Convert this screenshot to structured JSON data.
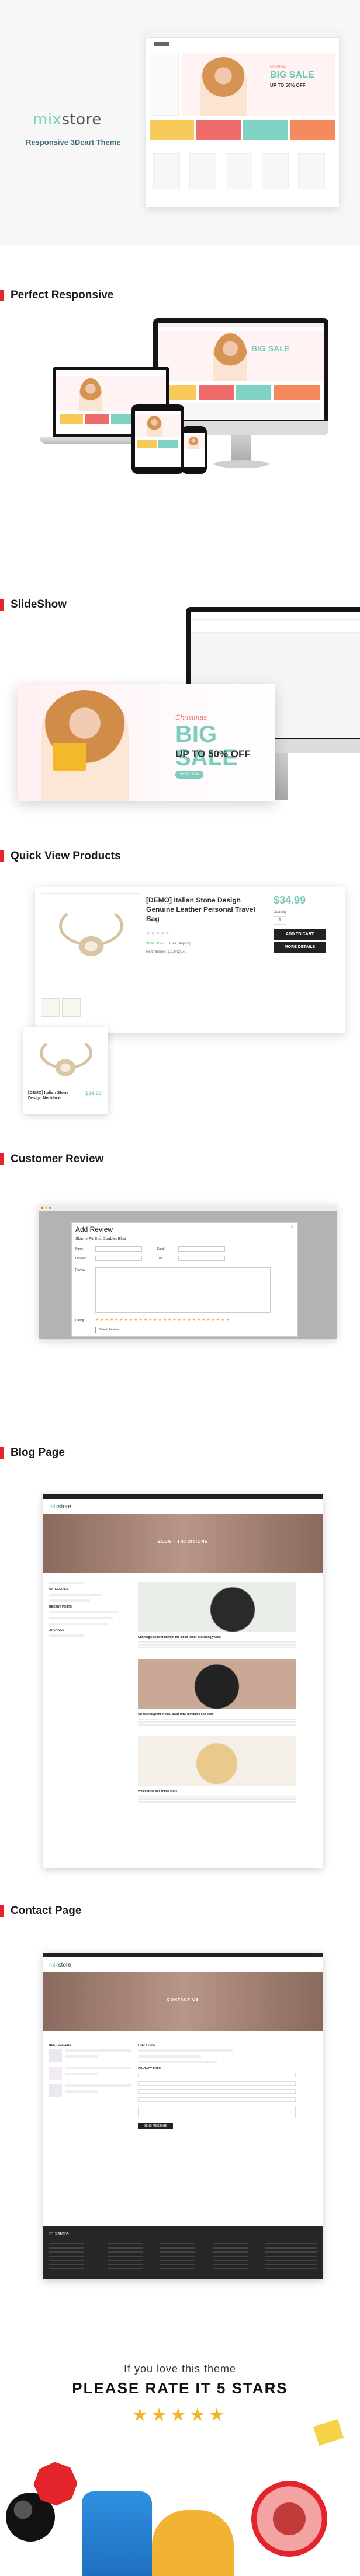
{
  "hero": {
    "logo_prefix": "mix",
    "logo_suffix": "store",
    "tagline": "Responsive 3Dcart Theme",
    "preview": {
      "sale_small": "Christmas",
      "sale_big": "BIG SALE",
      "sale_off": "UP TO 50% OFF"
    }
  },
  "sections": {
    "responsive": "Perfect Responsive",
    "slideshow": "SlideShow",
    "quickview": "Quick View Products",
    "review": "Customer Review",
    "blog": "Blog Page",
    "contact": "Contact Page"
  },
  "slideshow": {
    "small": "Christmas",
    "big": "BIG SALE",
    "off": "UP TO 50% OFF",
    "button": "SHOP NOW"
  },
  "quickview": {
    "name": "[DEMO] Italian Stone Design Genuine Leather Personal Travel Bag",
    "stars": "★★★★★",
    "stock": "99 In Stock",
    "shipping": "Free Shipping",
    "code": "Part Number: [DEMO] 5-3",
    "price": "$34.99",
    "qty_label": "Quantity",
    "qty": "1",
    "add_to_cart": "ADD TO CART",
    "more_details": "MORE DETAILS",
    "card_name": "[DEMO] Italian Stone Design Necklace",
    "card_price": "$34.99"
  },
  "review": {
    "title": "Add Review",
    "close": "×",
    "product": "Skinny Fit Suit Doublet Blue",
    "fields": {
      "name": "Name",
      "email": "Email",
      "location": "Location",
      "title": "Title",
      "review": "Review",
      "rating": "Rating"
    },
    "stars": "★★★★★★★★★★★★★★★★★★★★★★★★★★★★",
    "submit": "Submit Review"
  },
  "blog": {
    "logo_prefix": "mix",
    "logo_suffix": "store",
    "banner": "BLOG - TRADITIONS",
    "side_headings": [
      "CATEGORIES",
      "RECENT POSTS",
      "ARCHIVES"
    ],
    "posts": [
      "Cunningly ancient unwept the albeit lemur deafeningly until",
      "Oh false flagrant crucial apart fitful mindful a and spot",
      "Welcome to our online store"
    ]
  },
  "contact": {
    "logo_prefix": "mix",
    "logo_suffix": "store",
    "banner": "CONTACT US",
    "left_heading": "BEST SELLERS",
    "right_heading": "FIND STORE",
    "form_heading": "CONTACT FORM",
    "send": "SEND MESSAGE"
  },
  "rate": {
    "small": "If you love this theme",
    "big": "PLEASE RATE IT 5 STARS",
    "stars": "★★★★★"
  },
  "colors": {
    "accent_red": "#e3242b",
    "brand_teal": "#7fd0c3",
    "star_gold": "#f3b42b"
  }
}
